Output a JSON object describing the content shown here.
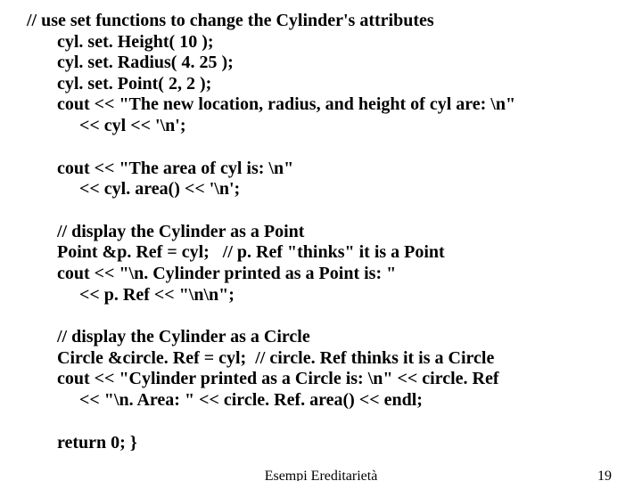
{
  "code": {
    "b1l1": "// use set functions to change the Cylinder's attributes",
    "b1l2": "cyl. set. Height( 10 );",
    "b1l3": "cyl. set. Radius( 4. 25 );",
    "b1l4": "cyl. set. Point( 2, 2 );",
    "b1l5": "cout << \"The new location, radius, and height of cyl are: \\n\"",
    "b1l6": "     << cyl << '\\n';",
    "b2l1": "cout << \"The area of cyl is: \\n\"",
    "b2l2": "     << cyl. area() << '\\n';",
    "b3l1": "// display the Cylinder as a Point",
    "b3l2": "Point &p. Ref = cyl;   // p. Ref \"thinks\" it is a Point",
    "b3l3": "cout << \"\\n. Cylinder printed as a Point is: \"",
    "b3l4": "     << p. Ref << \"\\n\\n\";",
    "b4l1": "// display the Cylinder as a Circle",
    "b4l2": "Circle &circle. Ref = cyl;  // circle. Ref thinks it is a Circle",
    "b4l3": "cout << \"Cylinder printed as a Circle is: \\n\" << circle. Ref",
    "b4l4": "     << \"\\n. Area: \" << circle. Ref. area() << endl;",
    "b5l1": "return 0; }"
  },
  "footer": {
    "center": "Esempi Ereditarietà",
    "page": "19"
  }
}
